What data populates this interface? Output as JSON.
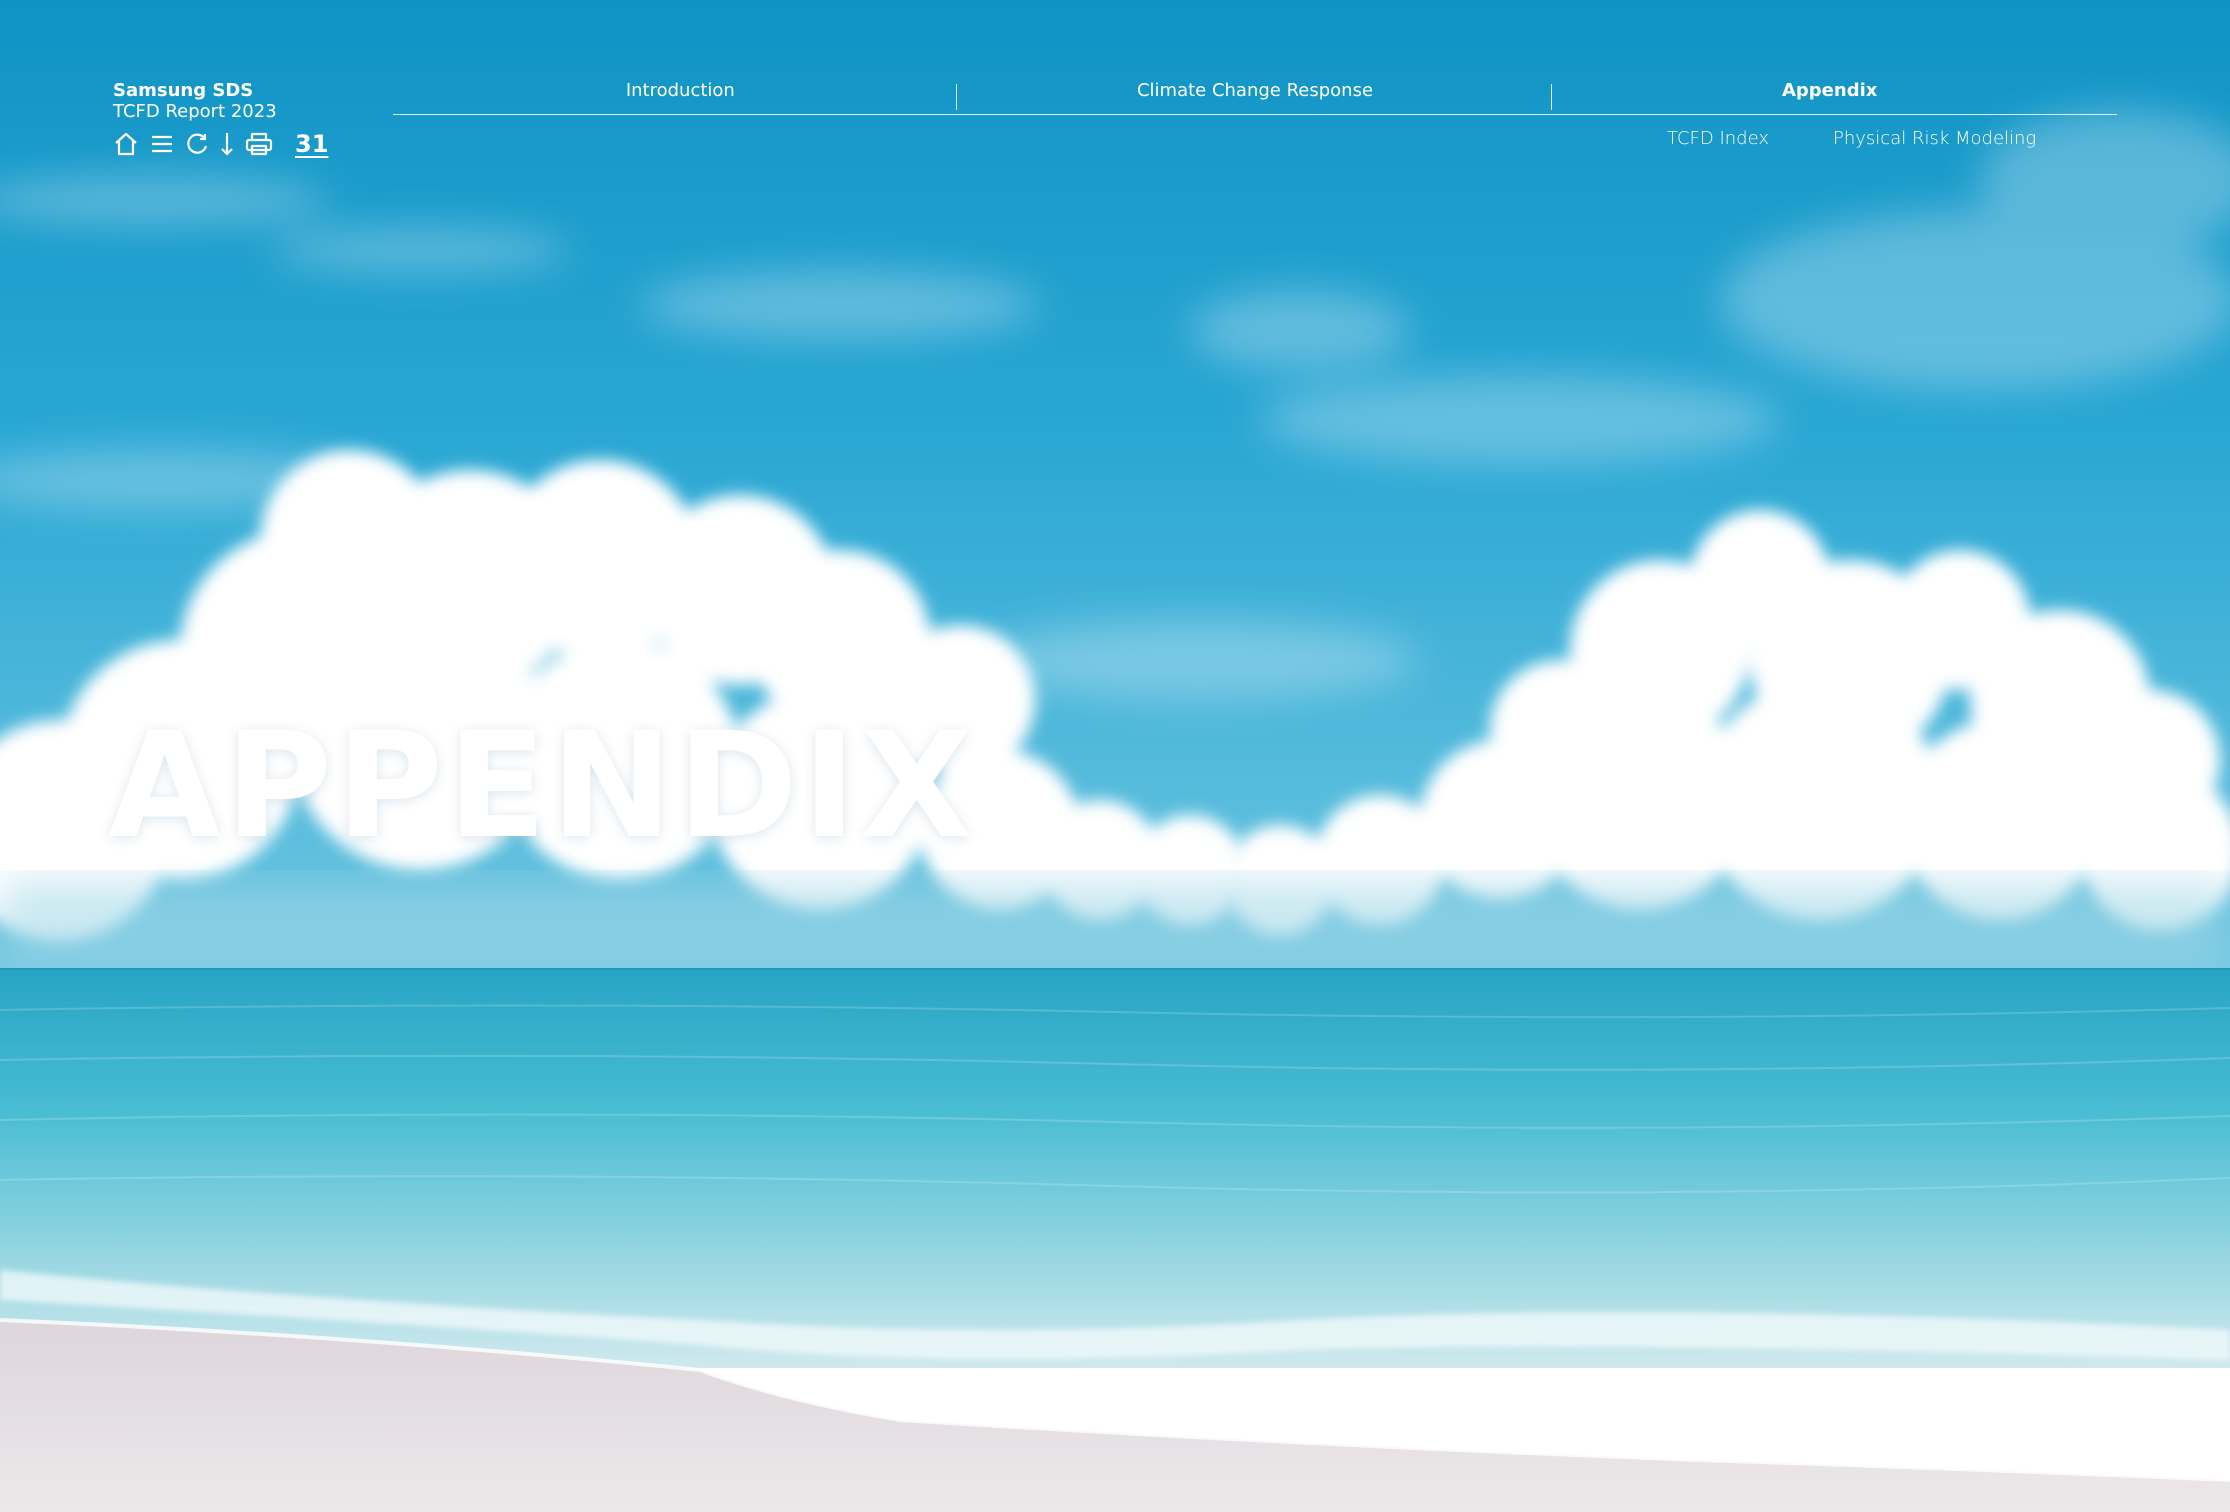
{
  "brand": {
    "company": "Samsung SDS",
    "report": "TCFD Report 2023"
  },
  "toolbar": {
    "icons": [
      "home-icon",
      "menu-icon",
      "refresh-icon",
      "download-icon",
      "print-icon"
    ],
    "page_number": "31"
  },
  "nav": {
    "tabs": [
      {
        "label": "Introduction",
        "active": false
      },
      {
        "label": "Climate Change Response",
        "active": false
      },
      {
        "label": "Appendix",
        "active": true
      }
    ],
    "subtabs": [
      {
        "label": "TCFD Index"
      },
      {
        "label": "Physical Risk Modeling"
      }
    ]
  },
  "hero": {
    "title": "APPENDIX"
  },
  "colors": {
    "sky_top": "#0f93c4",
    "sky_mid": "#38b0d6",
    "sea": "#49bcd3",
    "sand": "#e6e2e4",
    "text": "#ffffff"
  }
}
